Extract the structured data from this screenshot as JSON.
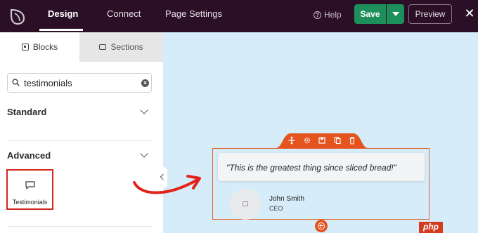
{
  "header": {
    "tabs": [
      {
        "label": "Design"
      },
      {
        "label": "Connect"
      },
      {
        "label": "Page Settings"
      }
    ],
    "help_label": "Help",
    "save_label": "Save",
    "preview_label": "Preview"
  },
  "sidebar": {
    "tabs": [
      {
        "label": "Blocks"
      },
      {
        "label": "Sections"
      }
    ],
    "search": {
      "value": "testimonials"
    },
    "sections": [
      {
        "label": "Standard"
      },
      {
        "label": "Advanced"
      }
    ],
    "block": {
      "label": "Testimonials"
    }
  },
  "canvas": {
    "quote": "\"This is the greatest thing since sliced bread!\"",
    "name": "John Smith",
    "role": "CEO"
  },
  "watermark": "php",
  "colors": {
    "topbar": "#2a0f26",
    "save": "#1d8f5a",
    "accent": "#e5541f",
    "highlight": "#d4271f",
    "canvas_bg": "#d6ecf8"
  }
}
